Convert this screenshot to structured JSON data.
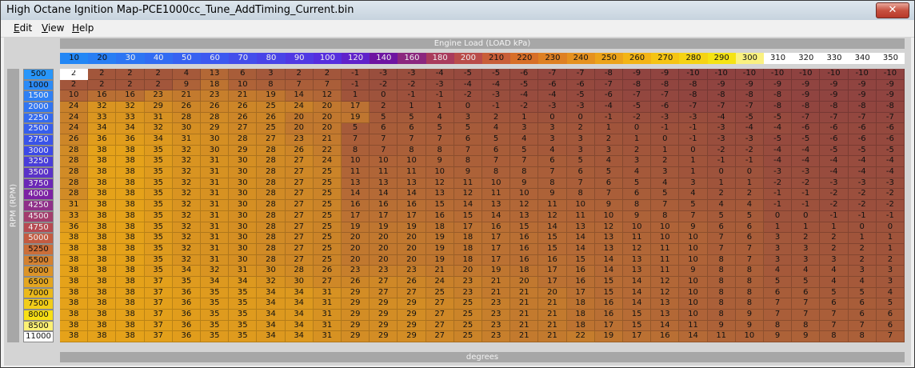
{
  "window": {
    "title": "High Octane Ignition Map-PCE1000cc_Tune_AddTiming_Current.bin",
    "close_label": "✕"
  },
  "menu": [
    {
      "label": "Edit",
      "mnemonic": "E",
      "rest": "dit"
    },
    {
      "label": "View",
      "mnemonic": "V",
      "rest": "iew"
    },
    {
      "label": "Help",
      "mnemonic": "H",
      "rest": "elp"
    }
  ],
  "labels": {
    "column_axis": "Engine Load (LOAD kPa)",
    "row_axis": "RPM (RPM)",
    "unit": "degrees"
  },
  "load_columns": [
    10,
    20,
    30,
    40,
    50,
    60,
    70,
    80,
    90,
    100,
    120,
    140,
    160,
    180,
    200,
    210,
    220,
    230,
    240,
    250,
    260,
    270,
    280,
    290,
    300,
    310,
    320,
    330,
    340,
    350
  ],
  "rpm_rows": [
    500,
    1000,
    1500,
    2000,
    2250,
    2500,
    2750,
    3000,
    3250,
    3500,
    3750,
    4000,
    4250,
    4500,
    4750,
    5000,
    5250,
    5500,
    6000,
    6500,
    7000,
    7500,
    8000,
    8500,
    11000
  ],
  "timing_values": [
    [
      2,
      2,
      2,
      2,
      4,
      13,
      6,
      3,
      2,
      2,
      -1,
      -3,
      -3,
      -4,
      -5,
      -5,
      -6,
      -7,
      -7,
      -8,
      -9,
      -9,
      -10,
      -10,
      -10,
      -10,
      -10,
      -10,
      -10,
      -10
    ],
    [
      2,
      2,
      2,
      2,
      9,
      18,
      10,
      8,
      7,
      7,
      -1,
      -2,
      -2,
      -3,
      -4,
      -4,
      -5,
      -6,
      -6,
      -7,
      -8,
      -8,
      -8,
      -9,
      -9,
      -9,
      -9,
      -9,
      -9,
      -9
    ],
    [
      10,
      16,
      16,
      23,
      21,
      23,
      21,
      19,
      14,
      12,
      1,
      0,
      -1,
      -1,
      -2,
      -3,
      -4,
      -4,
      -5,
      -6,
      -7,
      -7,
      -8,
      -8,
      -8,
      -8,
      -9,
      -9,
      -9,
      -9
    ],
    [
      24,
      32,
      32,
      29,
      26,
      26,
      26,
      25,
      24,
      20,
      17,
      2,
      1,
      1,
      0,
      -1,
      -2,
      -3,
      -3,
      -4,
      -5,
      -6,
      -7,
      -7,
      -7,
      -8,
      -8,
      -8,
      -8,
      -8
    ],
    [
      24,
      33,
      33,
      31,
      28,
      28,
      26,
      26,
      20,
      20,
      19,
      5,
      5,
      4,
      3,
      2,
      1,
      0,
      0,
      -1,
      -2,
      -3,
      -3,
      -4,
      -5,
      -5,
      -7,
      -7,
      -7,
      -7
    ],
    [
      24,
      34,
      34,
      32,
      30,
      29,
      27,
      25,
      20,
      20,
      5,
      6,
      6,
      5,
      5,
      4,
      3,
      3,
      2,
      1,
      0,
      -1,
      -1,
      -3,
      -4,
      -4,
      -6,
      -6,
      -6,
      -6
    ],
    [
      26,
      36,
      36,
      34,
      31,
      30,
      28,
      27,
      23,
      21,
      7,
      7,
      7,
      7,
      6,
      5,
      4,
      3,
      3,
      2,
      1,
      0,
      -1,
      -3,
      -3,
      -5,
      -5,
      -6,
      -6,
      -6
    ],
    [
      28,
      38,
      38,
      35,
      32,
      30,
      29,
      28,
      26,
      22,
      8,
      7,
      8,
      8,
      7,
      6,
      5,
      4,
      3,
      3,
      2,
      1,
      0,
      -2,
      -2,
      -4,
      -4,
      -5,
      -5,
      -5
    ],
    [
      28,
      38,
      38,
      35,
      32,
      31,
      30,
      28,
      27,
      24,
      10,
      10,
      10,
      9,
      8,
      7,
      7,
      6,
      5,
      4,
      3,
      2,
      1,
      -1,
      -1,
      -4,
      -4,
      -4,
      -4,
      -4
    ],
    [
      28,
      38,
      38,
      35,
      32,
      31,
      30,
      28,
      27,
      25,
      11,
      11,
      11,
      10,
      9,
      8,
      8,
      7,
      6,
      5,
      4,
      3,
      1,
      0,
      0,
      -3,
      -3,
      -4,
      -4,
      -4
    ],
    [
      28,
      38,
      38,
      35,
      32,
      31,
      30,
      28,
      27,
      25,
      13,
      13,
      13,
      12,
      11,
      10,
      9,
      8,
      7,
      6,
      5,
      4,
      3,
      1,
      1,
      -2,
      -2,
      -3,
      -3,
      -3
    ],
    [
      28,
      38,
      38,
      35,
      32,
      31,
      30,
      28,
      27,
      25,
      14,
      14,
      14,
      13,
      12,
      11,
      10,
      9,
      8,
      7,
      6,
      5,
      4,
      2,
      2,
      -1,
      -1,
      -2,
      -2,
      -2
    ],
    [
      31,
      38,
      38,
      35,
      32,
      31,
      30,
      28,
      27,
      25,
      16,
      16,
      16,
      15,
      14,
      13,
      12,
      11,
      10,
      9,
      8,
      7,
      5,
      4,
      4,
      -1,
      -1,
      -2,
      -2,
      -2
    ],
    [
      33,
      38,
      38,
      35,
      32,
      31,
      30,
      28,
      27,
      25,
      17,
      17,
      17,
      16,
      15,
      14,
      13,
      12,
      11,
      10,
      9,
      8,
      7,
      5,
      5,
      0,
      0,
      -1,
      -1,
      -1
    ],
    [
      36,
      38,
      38,
      35,
      32,
      31,
      30,
      28,
      27,
      25,
      19,
      19,
      19,
      18,
      17,
      16,
      15,
      14,
      13,
      12,
      10,
      10,
      9,
      6,
      6,
      1,
      1,
      1,
      0,
      0
    ],
    [
      38,
      38,
      38,
      35,
      32,
      31,
      30,
      28,
      27,
      25,
      20,
      20,
      20,
      19,
      18,
      17,
      16,
      15,
      14,
      13,
      11,
      10,
      10,
      7,
      6,
      3,
      2,
      2,
      1,
      1
    ],
    [
      38,
      38,
      38,
      35,
      32,
      31,
      30,
      28,
      27,
      25,
      20,
      20,
      20,
      19,
      18,
      17,
      16,
      15,
      14,
      13,
      12,
      11,
      10,
      7,
      7,
      3,
      3,
      2,
      2,
      1
    ],
    [
      38,
      38,
      38,
      35,
      32,
      31,
      30,
      28,
      27,
      25,
      20,
      20,
      20,
      19,
      18,
      17,
      16,
      16,
      15,
      14,
      13,
      11,
      10,
      8,
      7,
      3,
      3,
      3,
      2,
      2
    ],
    [
      38,
      38,
      38,
      35,
      34,
      32,
      31,
      30,
      28,
      26,
      23,
      23,
      23,
      21,
      20,
      19,
      18,
      17,
      16,
      14,
      13,
      11,
      9,
      8,
      8,
      4,
      4,
      4,
      3,
      3
    ],
    [
      38,
      38,
      38,
      37,
      35,
      34,
      34,
      32,
      30,
      27,
      26,
      27,
      26,
      24,
      23,
      21,
      20,
      17,
      16,
      15,
      14,
      12,
      10,
      8,
      8,
      5,
      5,
      4,
      4,
      3
    ],
    [
      38,
      38,
      38,
      37,
      36,
      35,
      35,
      34,
      34,
      31,
      29,
      27,
      27,
      25,
      23,
      21,
      21,
      20,
      17,
      15,
      14,
      12,
      10,
      8,
      8,
      6,
      6,
      5,
      5,
      4
    ],
    [
      38,
      38,
      38,
      37,
      36,
      35,
      35,
      34,
      34,
      31,
      29,
      29,
      29,
      27,
      25,
      23,
      21,
      21,
      18,
      16,
      14,
      13,
      10,
      8,
      8,
      7,
      7,
      6,
      6,
      5
    ],
    [
      38,
      38,
      38,
      37,
      36,
      35,
      35,
      34,
      34,
      31,
      29,
      29,
      29,
      27,
      25,
      23,
      21,
      21,
      18,
      16,
      15,
      13,
      10,
      8,
      9,
      7,
      7,
      7,
      6,
      6
    ],
    [
      38,
      38,
      38,
      37,
      36,
      35,
      35,
      34,
      34,
      31,
      29,
      29,
      29,
      27,
      25,
      23,
      21,
      21,
      18,
      17,
      15,
      14,
      11,
      9,
      9,
      8,
      8,
      7,
      7,
      6
    ],
    [
      38,
      38,
      38,
      37,
      36,
      35,
      35,
      34,
      34,
      31,
      29,
      29,
      29,
      27,
      25,
      23,
      21,
      21,
      22,
      19,
      17,
      16,
      14,
      11,
      10,
      9,
      9,
      8,
      8,
      7
    ]
  ],
  "selected_cell": {
    "row": 0,
    "col": 0
  },
  "colors": {
    "cell_low": "#8e4240",
    "cell_mid": "#b56a36",
    "cell_high": "#e5a21a"
  }
}
